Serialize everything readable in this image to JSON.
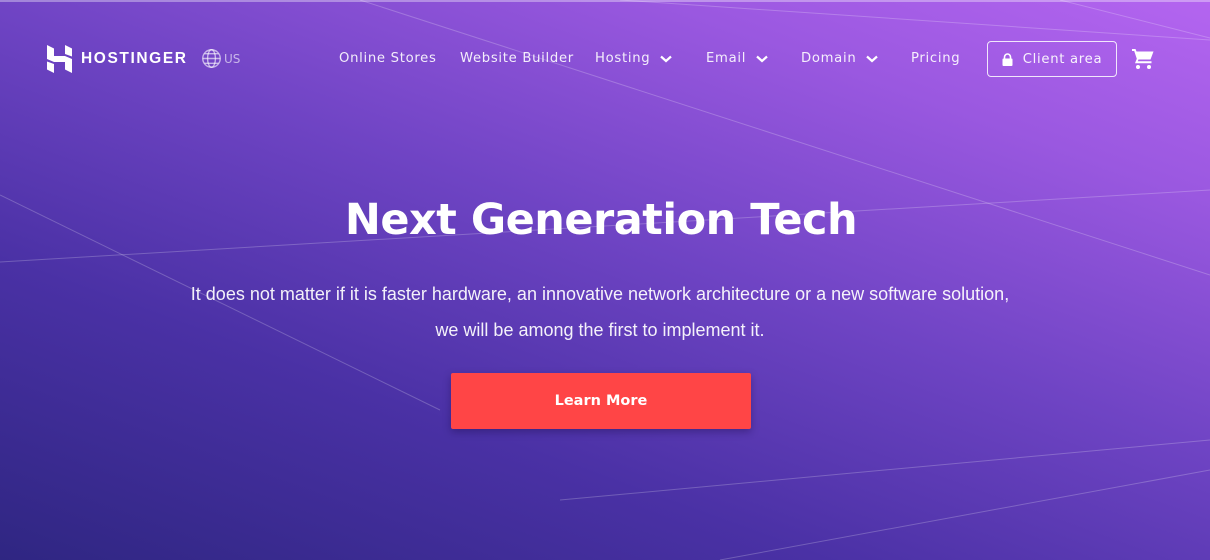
{
  "brand": {
    "name": "HOSTINGER",
    "locale": "US",
    "logo_icon": "hostinger-h-logo",
    "locale_icon": "globe-icon"
  },
  "nav": {
    "items": [
      {
        "label": "Online Stores",
        "has_dropdown": false
      },
      {
        "label": "Website Builder",
        "has_dropdown": false
      },
      {
        "label": "Hosting",
        "has_dropdown": true
      },
      {
        "label": "Email",
        "has_dropdown": true
      },
      {
        "label": "Domain",
        "has_dropdown": true
      },
      {
        "label": "Pricing",
        "has_dropdown": false
      }
    ],
    "client_area": {
      "label": "Client area",
      "icon": "lock-icon"
    },
    "cart_icon": "cart-icon"
  },
  "hero": {
    "title": "Next Generation Tech",
    "subtitle": "It does not matter if it is faster hardware, an innovative network architecture or a new software solution, we will be among the first to implement it.",
    "cta_label": "Learn More"
  },
  "colors": {
    "cta": "#ff4546",
    "bg_dark": "#2f2682",
    "bg_light": "#b465f0"
  }
}
